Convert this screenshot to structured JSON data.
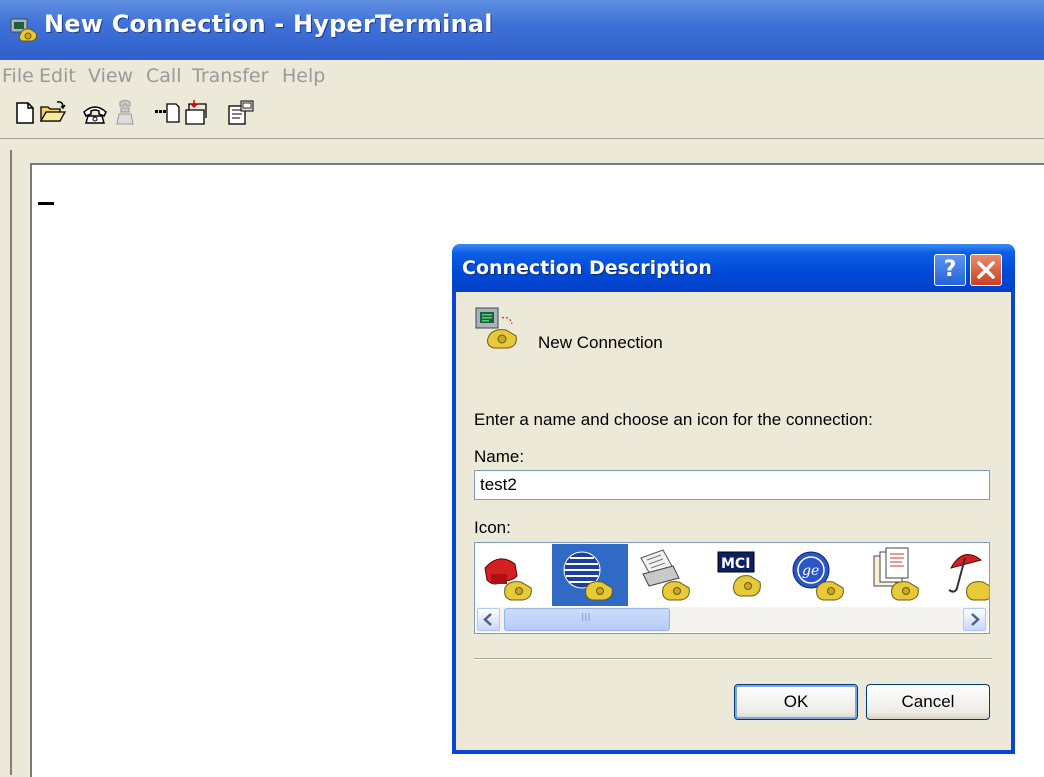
{
  "window": {
    "title": "New Connection - HyperTerminal"
  },
  "menu": {
    "items": [
      "File",
      "Edit",
      "View",
      "Call",
      "Transfer",
      "Help"
    ]
  },
  "toolbar": {
    "buttons": [
      "new-icon",
      "open-icon",
      "call-icon",
      "disconnect-icon",
      "send-icon",
      "receive-icon",
      "properties-icon"
    ]
  },
  "dialog": {
    "title": "Connection Description",
    "help_label": "?",
    "connection_name": "New Connection",
    "prompt": "Enter a name and choose an icon for the connection:",
    "name_label": "Name:",
    "name_value": "test2",
    "icon_label": "Icon:",
    "icons": [
      "red-phone-icon",
      "globe-phone-icon",
      "fax-phone-icon",
      "mci-phone-icon",
      "ge-phone-icon",
      "document-phone-icon",
      "umbrella-phone-icon"
    ],
    "selected_icon_index": 1,
    "scrollbar_grip": "III",
    "ok_label": "OK",
    "cancel_label": "Cancel"
  },
  "colors": {
    "titlebar": "#3f72d8",
    "dialog_titlebar": "#0049d8",
    "selection": "#316ac5",
    "face": "#ece9d8"
  }
}
